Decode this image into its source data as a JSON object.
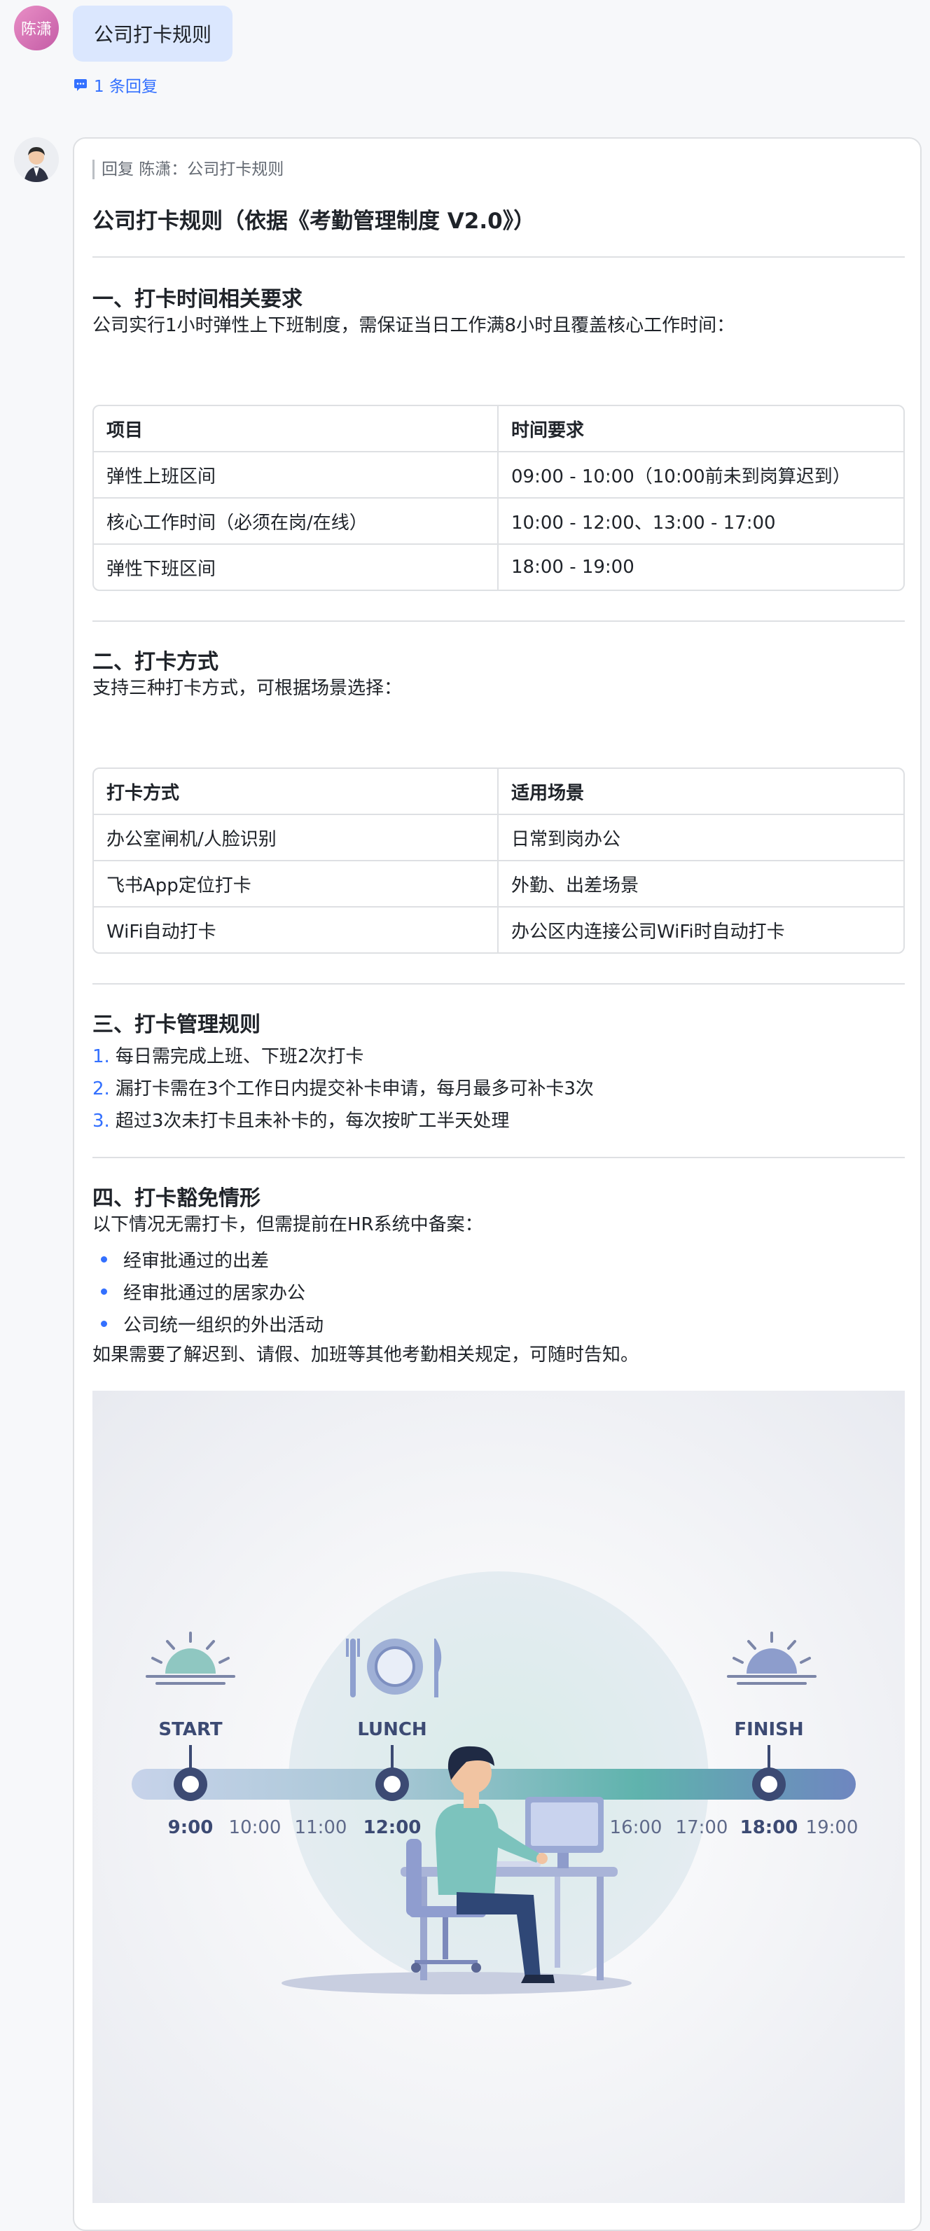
{
  "user": {
    "avatar_text": "陈潇",
    "message": "公司打卡规则"
  },
  "thread": {
    "reply_count": "1 条回复"
  },
  "reply": {
    "quote": "回复 陈潇：公司打卡规则",
    "title": "公司打卡规则（依据《考勤管理制度 V2.0》）",
    "section1": {
      "heading": "一、打卡时间相关要求",
      "intro": "公司实行1小时弹性上下班制度，需保证当日工作满8小时且覆盖核心工作时间：",
      "table": {
        "headers": [
          "项目",
          "时间要求"
        ],
        "rows": [
          [
            "弹性上班区间",
            "09:00 - 10:00（10:00前未到岗算迟到）"
          ],
          [
            "核心工作时间（必须在岗/在线）",
            "10:00 - 12:00、13:00 - 17:00"
          ],
          [
            "弹性下班区间",
            "18:00 - 19:00"
          ]
        ]
      }
    },
    "section2": {
      "heading": "二、打卡方式",
      "intro": "支持三种打卡方式，可根据场景选择：",
      "table": {
        "headers": [
          "打卡方式",
          "适用场景"
        ],
        "rows": [
          [
            "办公室闸机/人脸识别",
            "日常到岗办公"
          ],
          [
            "飞书App定位打卡",
            "外勤、出差场景"
          ],
          [
            "WiFi自动打卡",
            "办公区内连接公司WiFi时自动打卡"
          ]
        ]
      }
    },
    "section3": {
      "heading": "三、打卡管理规则",
      "items": [
        {
          "num": "1.",
          "text": "每日需完成上班、下班2次打卡"
        },
        {
          "num": "2.",
          "text": "漏打卡需在3个工作日内提交补卡申请，每月最多可补卡3次"
        },
        {
          "num": "3.",
          "text": "超过3次未打卡且未补卡的，每次按旷工半天处理"
        }
      ]
    },
    "section4": {
      "heading": "四、打卡豁免情形",
      "intro": "以下情况无需打卡，但需提前在HR系统中备案：",
      "bullets": [
        "经审批通过的出差",
        "经审批通过的居家办公",
        "公司统一组织的外出活动"
      ],
      "outro": "如果需要了解迟到、请假、加班等其他考勤相关规定，可随时告知。"
    },
    "illustration": {
      "labels": {
        "start": "START",
        "lunch": "LUNCH",
        "finish": "FINISH"
      },
      "times": [
        "9:00",
        "10:00",
        "11:00",
        "12:00",
        "16:00",
        "17:00",
        "18:00",
        "19:00"
      ]
    }
  },
  "colors": {
    "accent": "#3370ff",
    "bubble": "#dbe7fe",
    "teal": "#5fb3ad",
    "navy": "#3c4a73"
  }
}
